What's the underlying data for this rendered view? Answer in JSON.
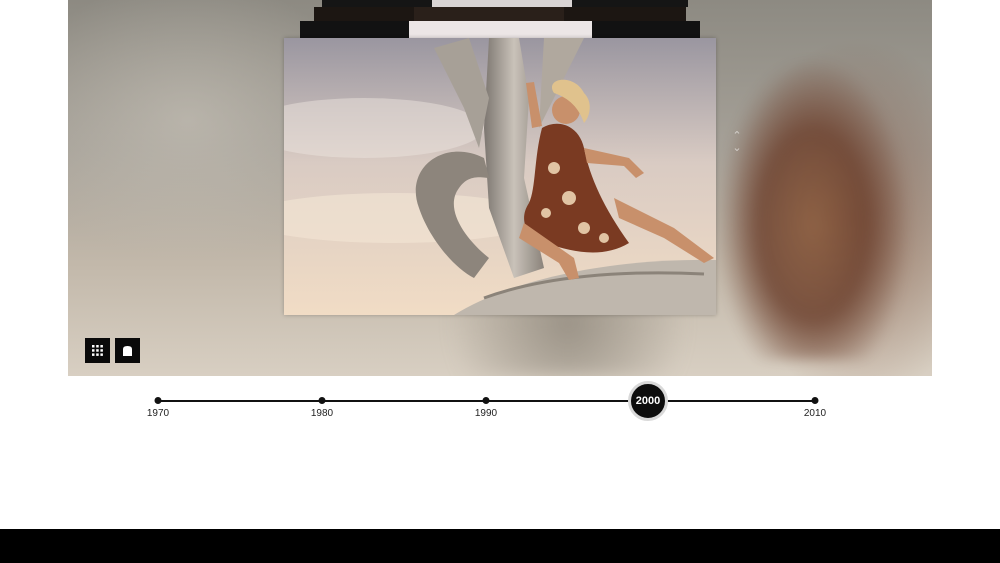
{
  "gallery": {
    "nav": {
      "prev_icon": "chevron-up-icon",
      "next_icon": "chevron-down-icon"
    },
    "controls": {
      "grid_icon": "grid-view-icon",
      "single_icon": "single-view-icon"
    },
    "main_image": {
      "subject": "photo"
    }
  },
  "timeline": {
    "active_year": "2000",
    "years": [
      "1970",
      "1980",
      "1990",
      "2000",
      "2010"
    ]
  },
  "colors": {
    "accent": "#0d0d0d",
    "timeline_line": "#111111",
    "footer": "#000000"
  }
}
